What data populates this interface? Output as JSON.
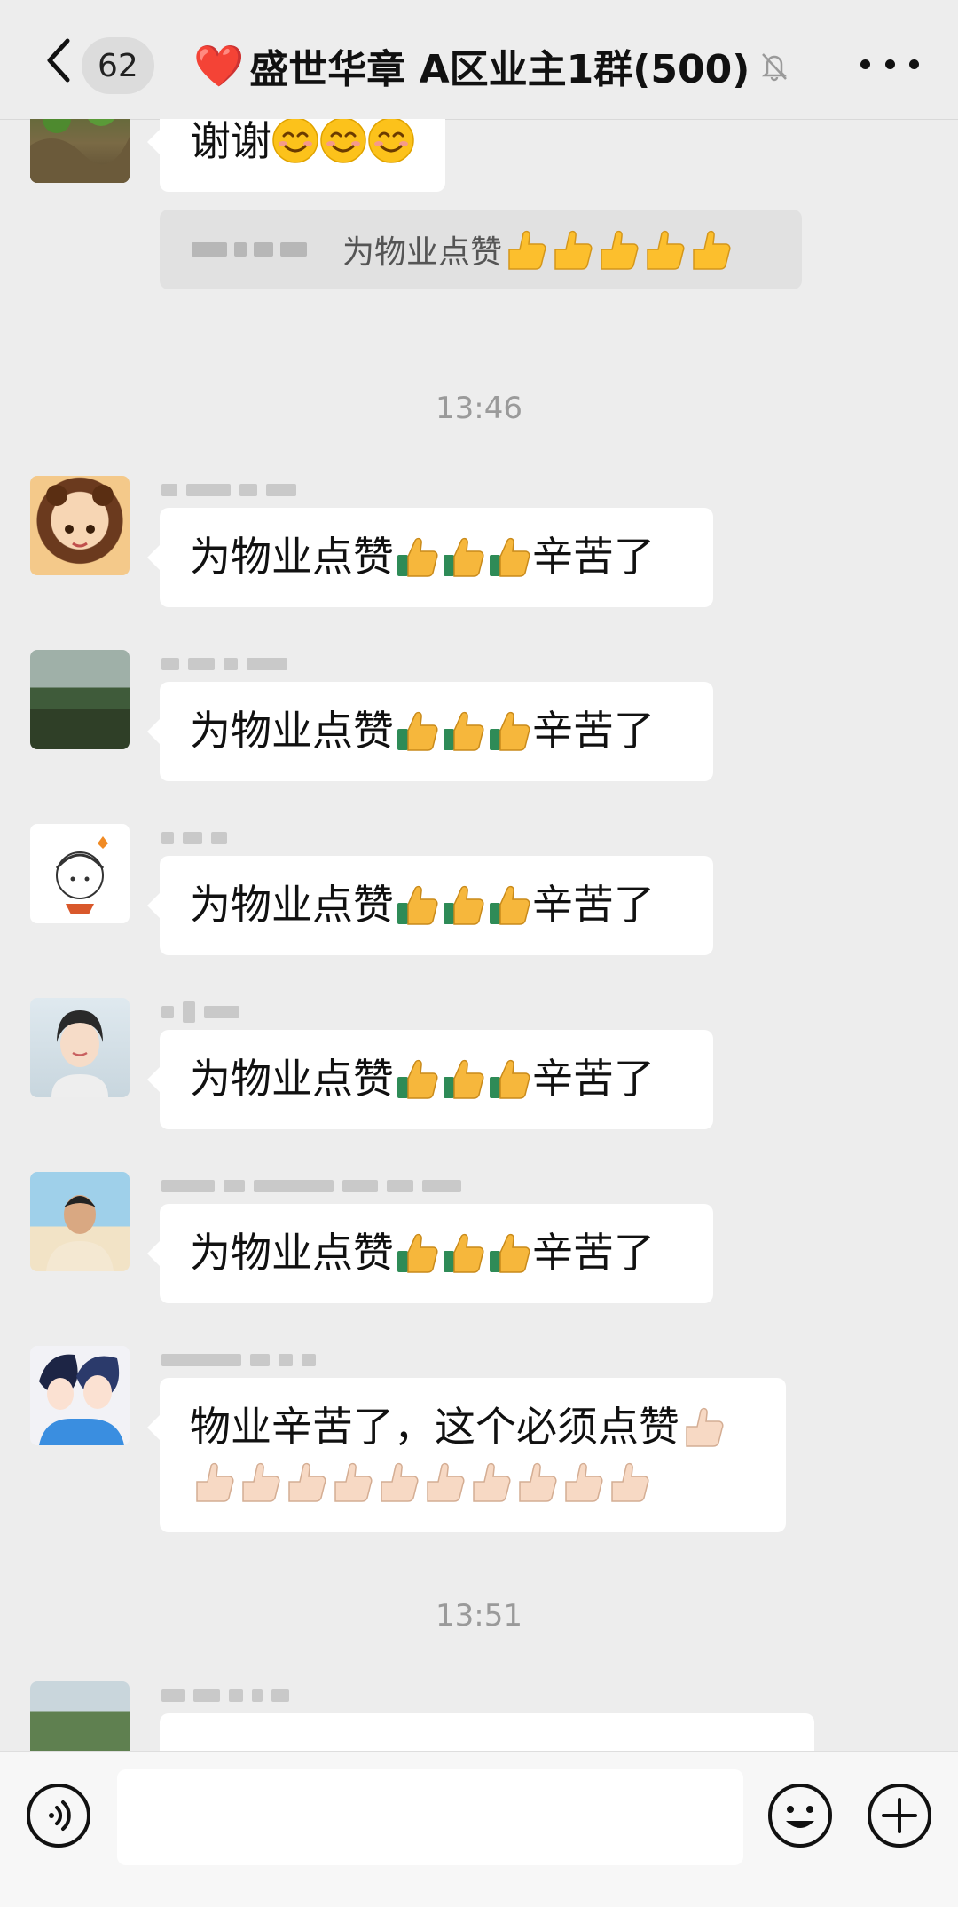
{
  "header": {
    "unread_count": "62",
    "title": "盛世华章 A区业主1群(500)",
    "heart": "❤️"
  },
  "messages": [
    {
      "text_prefix": "谢谢",
      "reactions": "😊😊😊",
      "quote": {
        "text": "为物业点赞",
        "emoji": "👍👍👍👍👍"
      }
    },
    {
      "timestamp": "13:46"
    },
    {
      "text_prefix": "为物业点赞",
      "emoji": "👍👍👍",
      "text_suffix": "辛苦了"
    },
    {
      "text_prefix": "为物业点赞",
      "emoji": "👍👍👍",
      "text_suffix": "辛苦了"
    },
    {
      "text_prefix": "为物业点赞",
      "emoji": "👍👍👍",
      "text_suffix": "辛苦了"
    },
    {
      "text_prefix": "为物业点赞",
      "emoji": "👍👍👍",
      "text_suffix": "辛苦了"
    },
    {
      "text_prefix": "为物业点赞",
      "emoji": "👍👍👍",
      "text_suffix": "辛苦了"
    },
    {
      "text": "物业辛苦了，这个必须点赞",
      "emoji": "👍👍👍👍👍👍👍👍👍👍👍"
    },
    {
      "timestamp": "13:51"
    }
  ],
  "colors": {
    "bg": "#ededed",
    "bubble": "#ffffff",
    "accent_heart": "#e8202a"
  },
  "icons": [
    "chevron-left-icon",
    "mute-bell-icon",
    "more-dots-icon",
    "voice-icon",
    "emoji-icon",
    "plus-icon",
    "thumbs-up-icon",
    "smiling-face-icon"
  ]
}
